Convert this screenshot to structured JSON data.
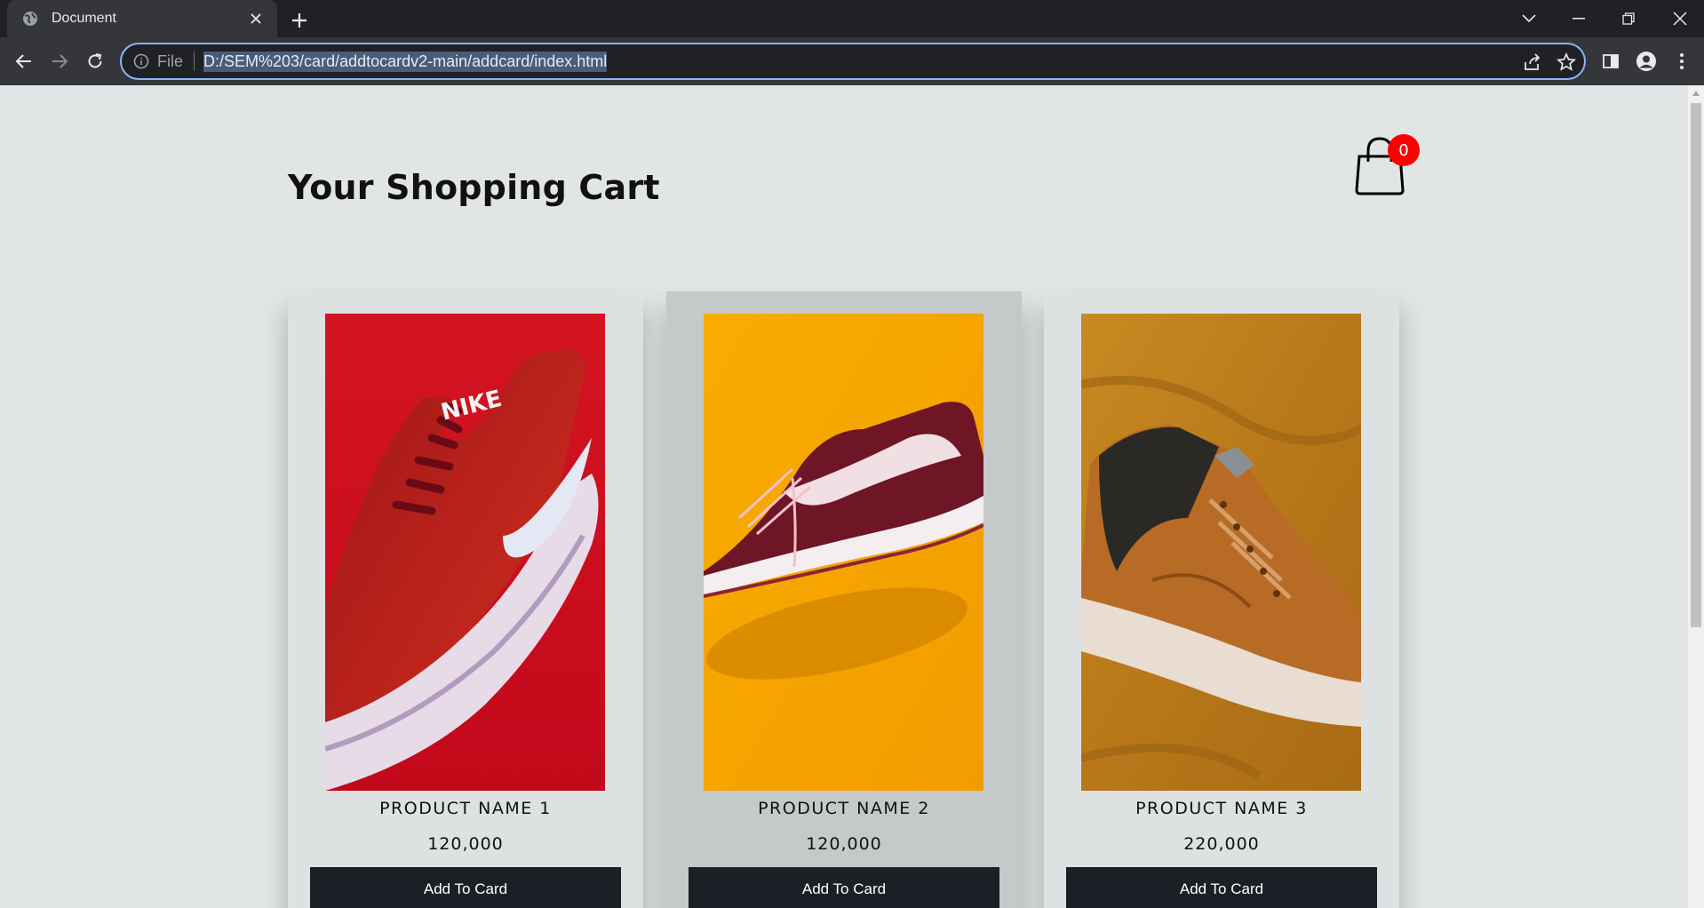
{
  "browser": {
    "tab_title": "Document",
    "omnibox": {
      "scheme_label": "File",
      "url": "D:/SEM%203/card/addtocardv2-main/addcard/index.html"
    }
  },
  "page": {
    "title": "Your Shopping Cart",
    "cart_count": "0",
    "products": [
      {
        "name": "PRODUCT NAME 1",
        "price": "120,000",
        "button_label": "Add To Card",
        "image_icon": "red-nike-sneaker-image"
      },
      {
        "name": "PRODUCT NAME 2",
        "price": "120,000",
        "button_label": "Add To Card",
        "image_icon": "maroon-vans-sneaker-image"
      },
      {
        "name": "PRODUCT NAME 3",
        "price": "220,000",
        "button_label": "Add To Card",
        "image_icon": "tan-carhartt-sneaker-image"
      }
    ]
  },
  "colors": {
    "page_background": "#e2e5e6",
    "card_background": "#dee1e2",
    "card_hover_background": "#c5c9ca",
    "button_background": "#1c1f25",
    "badge_background": "#fe0000",
    "omnibox_focus": "#8ab4f8"
  }
}
